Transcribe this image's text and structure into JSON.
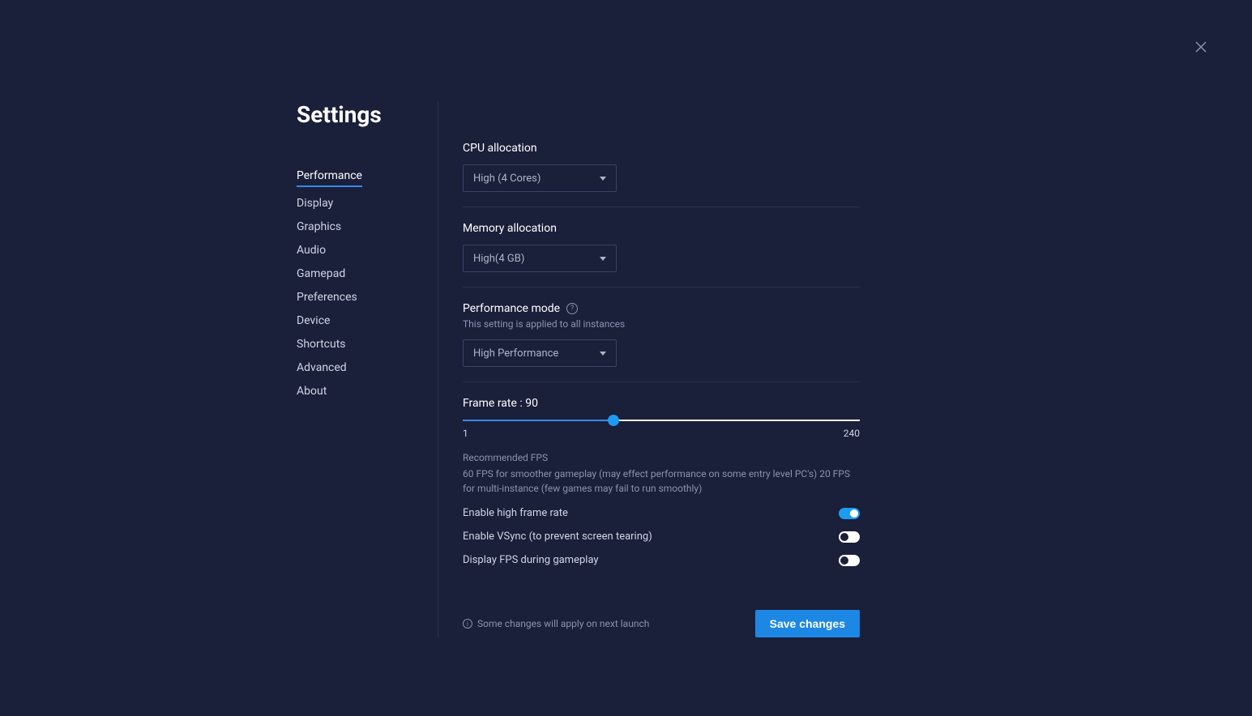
{
  "title": "Settings",
  "nav": {
    "items": [
      {
        "label": "Performance",
        "active": true
      },
      {
        "label": "Display",
        "active": false
      },
      {
        "label": "Graphics",
        "active": false
      },
      {
        "label": "Audio",
        "active": false
      },
      {
        "label": "Gamepad",
        "active": false
      },
      {
        "label": "Preferences",
        "active": false
      },
      {
        "label": "Device",
        "active": false
      },
      {
        "label": "Shortcuts",
        "active": false
      },
      {
        "label": "Advanced",
        "active": false
      },
      {
        "label": "About",
        "active": false
      }
    ]
  },
  "cpu": {
    "label": "CPU allocation",
    "value": "High (4 Cores)"
  },
  "memory": {
    "label": "Memory allocation",
    "value": "High(4 GB)"
  },
  "perfmode": {
    "label": "Performance mode",
    "subtext": "This setting is applied to all instances",
    "value": "High Performance"
  },
  "frame": {
    "label": "Frame rate : 90",
    "min": "1",
    "max": "240",
    "percent": 38,
    "rec_title": "Recommended FPS",
    "rec_body": "60 FPS for smoother gameplay (may effect performance on some entry level PC's) 20 FPS for multi-instance (few games may fail to run smoothly)"
  },
  "toggles": {
    "high_frame": {
      "label": "Enable high frame rate",
      "on": true
    },
    "vsync": {
      "label": "Enable VSync (to prevent screen tearing)",
      "on": false
    },
    "display_fps": {
      "label": "Display FPS during gameplay",
      "on": false
    }
  },
  "footer": {
    "note": "Some changes will apply on next launch",
    "save": "Save changes"
  }
}
